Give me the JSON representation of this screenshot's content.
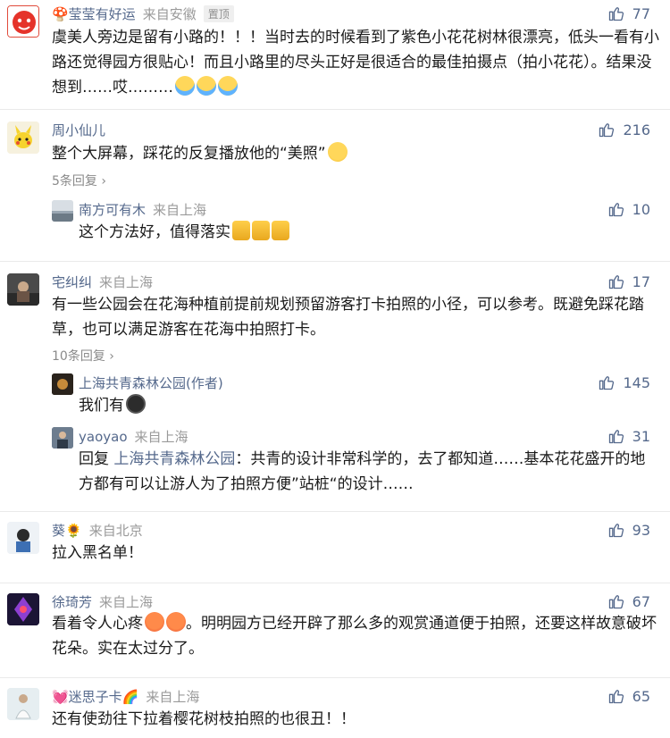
{
  "comments": [
    {
      "username": "🍄莹莹有好运",
      "location": "来自安徽",
      "pin_label": "置顶",
      "likes": "77",
      "text": "虞美人旁边是留有小路的！！！当时去的时候看到了紫色小花花树林很漂亮，低头一看有小路还觉得园方很贴心！而且小路里的尽头正好是很适合的最佳拍摄点（拍小花花）。结果没想到……哎………",
      "emojis": [
        "crying-face",
        "crying-face",
        "crying-face"
      ]
    },
    {
      "username": "周小仙儿",
      "location": "",
      "likes": "216",
      "text": "整个大屏幕，踩花的反复播放他的“美照”",
      "emojis": [
        "smirk-face"
      ],
      "replies_link": "5条回复",
      "replies": [
        {
          "username": "南方可有木",
          "location": "来自上海",
          "likes": "10",
          "text": "这个方法好，值得落实",
          "emojis": [
            "thumbs-up",
            "thumbs-up",
            "thumbs-up"
          ]
        }
      ]
    },
    {
      "username": "宅纠纠",
      "location": "来自上海",
      "likes": "17",
      "text": "有一些公园会在花海种植前提前规划预留游客打卡拍照的小径，可以参考。既避免踩花踏草，也可以满足游客在花海中拍照打卡。",
      "replies_link": "10条回复",
      "replies": [
        {
          "username": "上海共青森林公园(作者)",
          "location": "",
          "likes": "145",
          "text": "我们有",
          "emojis": [
            "devil-face"
          ]
        },
        {
          "username": "yaoyao",
          "location": "来自上海",
          "likes": "31",
          "text_prefix": "回复 ",
          "mention": "上海共青森林公园",
          "text": "：共青的设计非常科学的，去了都知道……基本花花盛开的地方都有可以让游人为了拍照方便”站桩“的设计……"
        }
      ]
    },
    {
      "username": "葵🌻",
      "location": "来自北京",
      "likes": "93",
      "text": "拉入黑名单！"
    },
    {
      "username": "徐琦芳",
      "location": "来自上海",
      "likes": "67",
      "text_a": "看着令人心疼",
      "text_b": "。明明园方已经开辟了那么多的观赏通道便于拍照，还要这样故意破坏花朵。实在太过分了。",
      "emojis": [
        "angry-face",
        "angry-face"
      ]
    },
    {
      "username": "💓迷思子卡🌈",
      "location": "来自上海",
      "likes": "65",
      "text": "还有使劲往下拉着樱花树枝拍照的也很丑！！"
    }
  ],
  "colors": {
    "username": "#55698c",
    "location": "#9a9a9a",
    "body_text": "#1a1a1a",
    "like": "#55698c"
  }
}
